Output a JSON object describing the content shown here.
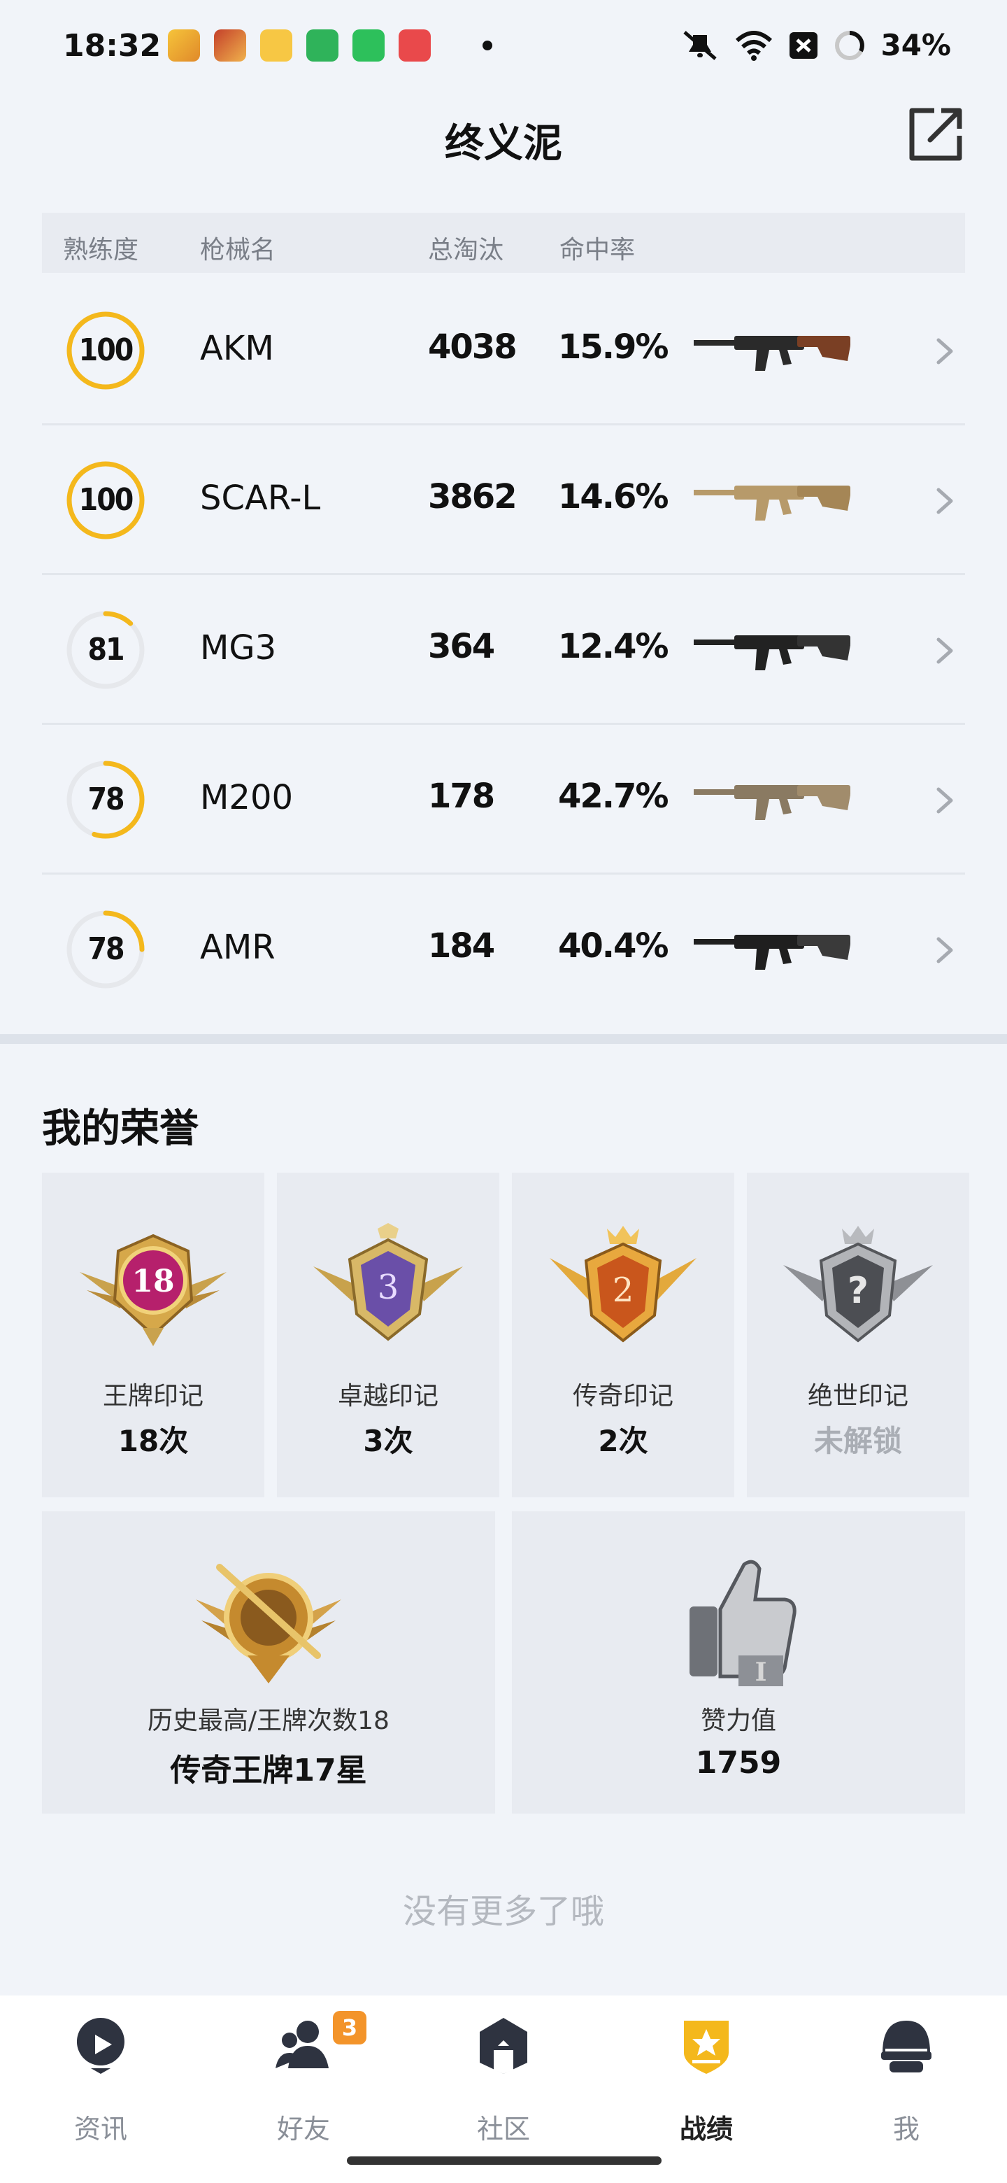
{
  "status_bar": {
    "time": "18:32",
    "battery": "34%"
  },
  "header": {
    "title": "终义泥"
  },
  "table": {
    "headers": [
      "熟练度",
      "枪械名",
      "总淘汰",
      "命中率"
    ],
    "rows": [
      {
        "proficiency": "100",
        "progress": 1.0,
        "name": "AKM",
        "kills": "4038",
        "hit_rate": "15.9%",
        "style": "dark-ak"
      },
      {
        "proficiency": "100",
        "progress": 1.0,
        "name": "SCAR-L",
        "kills": "3862",
        "hit_rate": "14.6%",
        "style": "tan"
      },
      {
        "proficiency": "81",
        "progress": 0.12,
        "name": "MG3",
        "kills": "364",
        "hit_rate": "12.4%",
        "style": "black-lmg"
      },
      {
        "proficiency": "78",
        "progress": 0.55,
        "name": "M200",
        "kills": "178",
        "hit_rate": "42.7%",
        "style": "sniper-tan"
      },
      {
        "proficiency": "78",
        "progress": 0.25,
        "name": "AMR",
        "kills": "184",
        "hit_rate": "40.4%",
        "style": "black-sniper"
      }
    ]
  },
  "honor": {
    "title": "我的荣誉",
    "badges": [
      {
        "name": "王牌印记",
        "count": "18次",
        "numeral": "18",
        "icon": "ace-badge-icon"
      },
      {
        "name": "卓越印记",
        "count": "3次",
        "numeral": "3",
        "icon": "excellence-badge-icon"
      },
      {
        "name": "传奇印记",
        "count": "2次",
        "numeral": "2",
        "icon": "legend-badge-icon"
      },
      {
        "name": "绝世印记",
        "count": "未解锁",
        "numeral": "?",
        "icon": "peerless-badge-icon"
      }
    ],
    "highest": {
      "label": "历史最高/王牌次数18",
      "value": "传奇王牌17星"
    },
    "likes": {
      "label": "赞力值",
      "value": "1759"
    }
  },
  "footer_note": "没有更多了哦",
  "bottom_nav": {
    "items": [
      {
        "label": "资讯"
      },
      {
        "label": "好友",
        "badge": "3"
      },
      {
        "label": "社区"
      },
      {
        "label": "战绩",
        "active": true
      },
      {
        "label": "我"
      }
    ]
  },
  "colors": {
    "accent": "#f4b81c",
    "ring_track": "#e6e8ec",
    "badge": "#f3942a"
  }
}
